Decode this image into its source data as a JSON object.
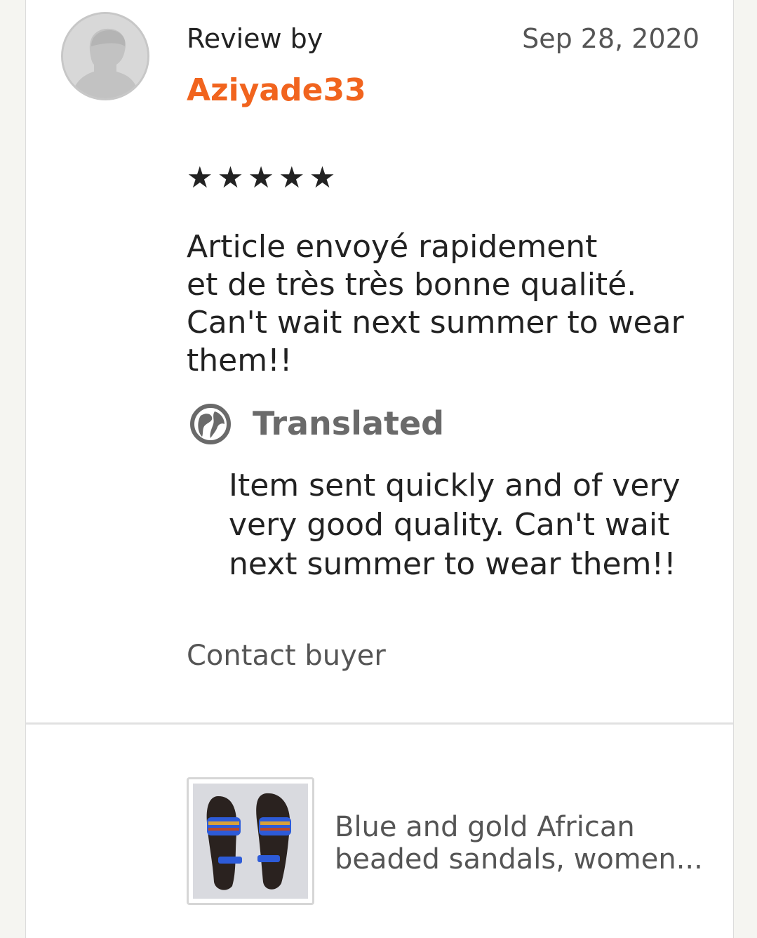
{
  "review": {
    "header_label": "Review by",
    "reviewer_name": "Aziyade33",
    "date": "Sep 28, 2020",
    "rating": 5,
    "rating_display": "★★★★★",
    "text": "Article envoyé rapidement\net de très très bonne qualité.\nCan't wait next summer to wear them!!",
    "translated_label": "Translated",
    "translated_text": "Item sent quickly and of very very good quality. Can't wait next summer to wear them!!",
    "contact_label": "Contact buyer"
  },
  "listing": {
    "title": "Blue and gold African beaded sandals, women..."
  },
  "colors": {
    "accent": "#f1641e",
    "text": "#222222",
    "muted": "#555555",
    "background": "#f5f5f1"
  },
  "icons": {
    "avatar": "default-user-avatar",
    "translate": "globe-icon"
  }
}
